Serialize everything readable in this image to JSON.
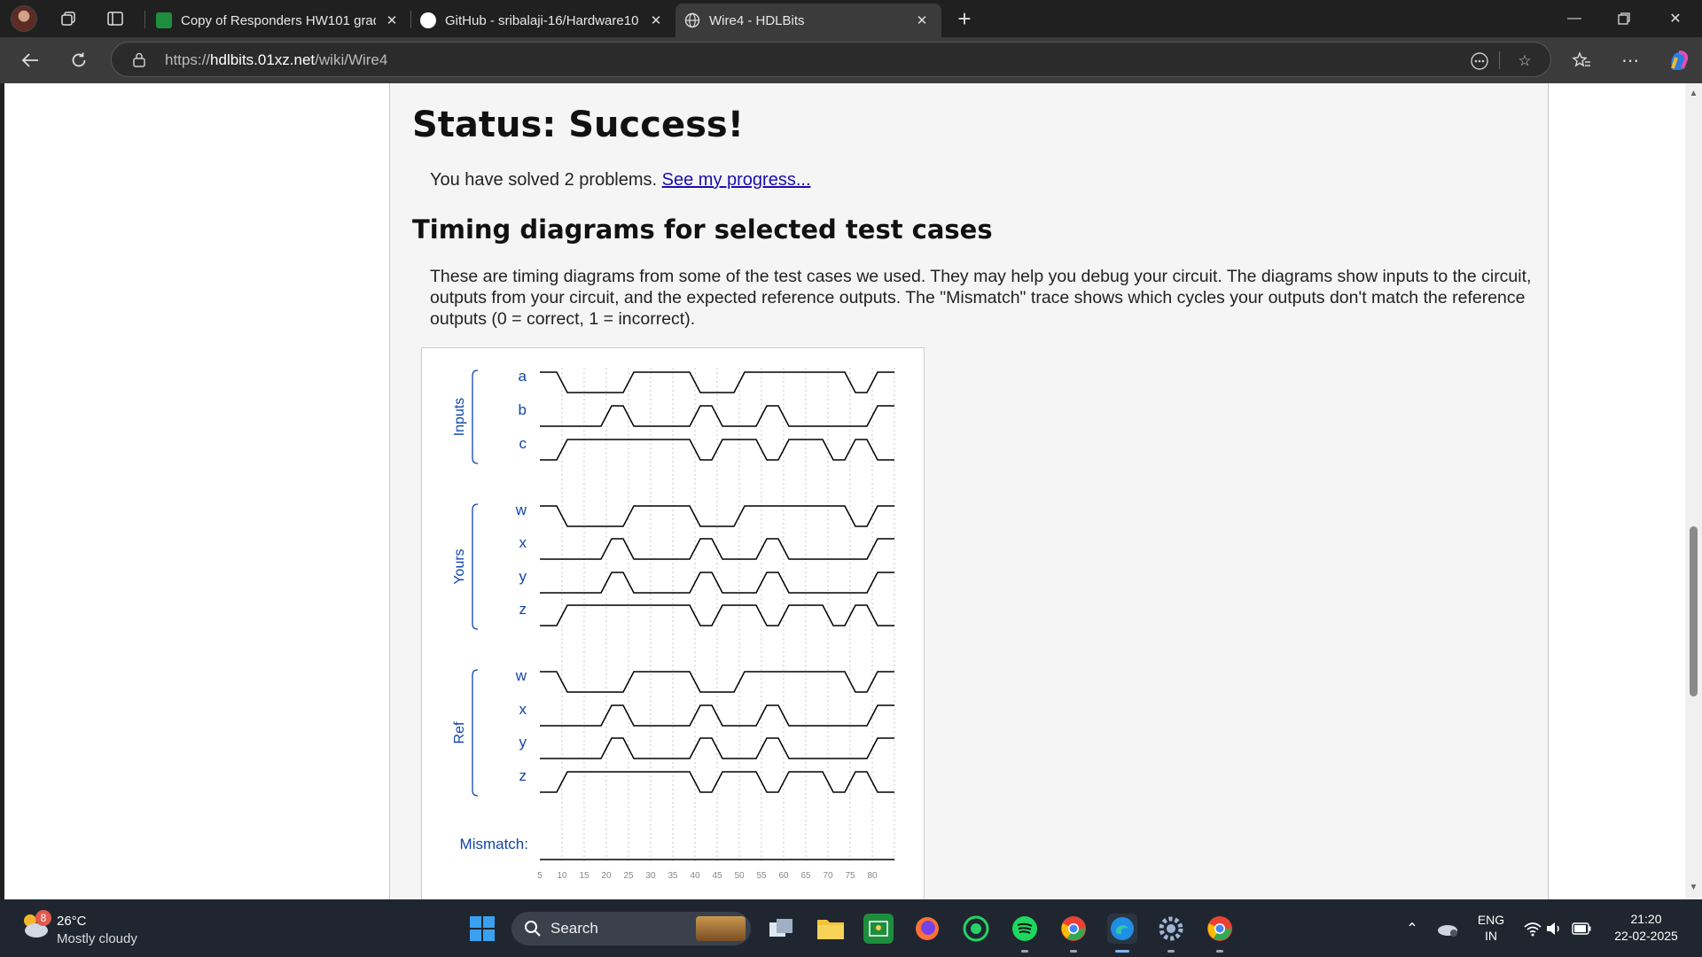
{
  "tabs": [
    {
      "title": "Copy of Responders HW101 grad",
      "active": false
    },
    {
      "title": "GitHub - sribalaji-16/Hardware10",
      "active": false
    },
    {
      "title": "Wire4 - HDLBits",
      "active": true
    }
  ],
  "address": {
    "scheme": "https://",
    "host": "hdlbits.01xz.net",
    "path": "/wiki/Wire4"
  },
  "page": {
    "status_title": "Status: Success!",
    "solved_text": "You have solved 2 problems.",
    "progress_link": "See my progress...",
    "timing_heading": "Timing diagrams for selected test cases",
    "description": "These are timing diagrams from some of the test cases we used. They may help you debug your circuit. The diagrams show inputs to the circuit, outputs from your circuit, and the expected reference outputs. The \"Mismatch\" trace shows which cycles your outputs don't match the reference outputs (0 = correct, 1 = incorrect)."
  },
  "diagram": {
    "groups": [
      {
        "label": "Inputs",
        "signals": [
          "a",
          "b",
          "c"
        ]
      },
      {
        "label": "Yours",
        "signals": [
          "w",
          "x",
          "y",
          "z"
        ]
      },
      {
        "label": "Ref",
        "signals": [
          "w",
          "x",
          "y",
          "z"
        ]
      }
    ],
    "mismatch_label": "Mismatch:",
    "time_ticks": [
      "5",
      "10",
      "15",
      "20",
      "25",
      "30",
      "35",
      "40",
      "45",
      "50",
      "55",
      "60",
      "65",
      "70",
      "75",
      "80"
    ],
    "waveforms": {
      "a": [
        1,
        0,
        0,
        0,
        1,
        1,
        1,
        0,
        0,
        1,
        1,
        1,
        1,
        1,
        0,
        1
      ],
      "b": [
        0,
        0,
        0,
        1,
        0,
        0,
        0,
        1,
        0,
        0,
        1,
        0,
        0,
        0,
        0,
        1
      ],
      "c": [
        0,
        1,
        1,
        1,
        1,
        1,
        1,
        0,
        1,
        1,
        0,
        1,
        1,
        0,
        1,
        0
      ],
      "w": [
        1,
        0,
        0,
        0,
        1,
        1,
        1,
        0,
        0,
        1,
        1,
        1,
        1,
        1,
        0,
        1
      ],
      "x": [
        0,
        0,
        0,
        1,
        0,
        0,
        0,
        1,
        0,
        0,
        1,
        0,
        0,
        0,
        0,
        1
      ],
      "y": [
        0,
        0,
        0,
        1,
        0,
        0,
        0,
        1,
        0,
        0,
        1,
        0,
        0,
        0,
        0,
        1
      ],
      "z": [
        0,
        1,
        1,
        1,
        1,
        1,
        1,
        0,
        1,
        1,
        0,
        1,
        1,
        0,
        1,
        0
      ],
      "mismatch": [
        0,
        0,
        0,
        0,
        0,
        0,
        0,
        0,
        0,
        0,
        0,
        0,
        0,
        0,
        0,
        0
      ]
    },
    "colors": {
      "label": "#1144aa",
      "wave": "#000000",
      "grid": "#c8c8c8"
    }
  },
  "taskbar": {
    "weather_temp": "26°C",
    "weather_desc": "Mostly cloudy",
    "weather_badge": "8",
    "search_label": "Search",
    "lang_top": "ENG",
    "lang_bottom": "IN",
    "time": "21:20",
    "date": "22-02-2025"
  }
}
